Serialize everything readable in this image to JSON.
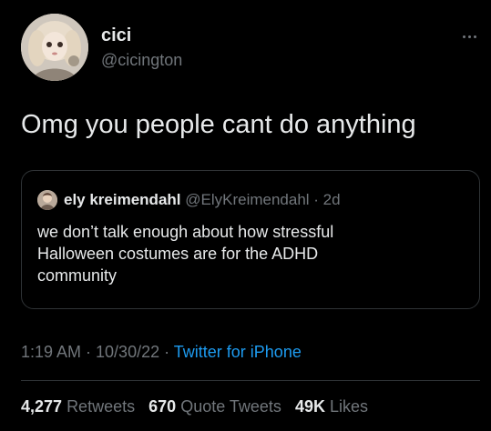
{
  "author": {
    "display_name": "cici",
    "handle": "@cicington",
    "avatar_icon": "doll-avatar"
  },
  "more_icon": "more-horizontal-icon",
  "tweet": {
    "text": "Omg you people cant do anything"
  },
  "quoted": {
    "display_name": "ely kreimendahl",
    "handle_time": "@ElyKreimendahl · 2d",
    "lines": [
      "we don’t talk enough about how stressful",
      "Halloween costumes are for the ADHD",
      "community"
    ]
  },
  "meta": {
    "time_date": "1:19 AM · 10/30/22 · ",
    "source": "Twitter for iPhone"
  },
  "stats": {
    "retweets_count": "4,277",
    "retweets_label": "Retweets",
    "quotes_count": "670",
    "quotes_label": "Quote Tweets",
    "likes_count": "49K",
    "likes_label": "Likes"
  },
  "colors": {
    "background": "#000000",
    "text": "#e7e9ea",
    "secondary": "#71767b",
    "link": "#1d9bf0",
    "border": "#2f3336"
  }
}
